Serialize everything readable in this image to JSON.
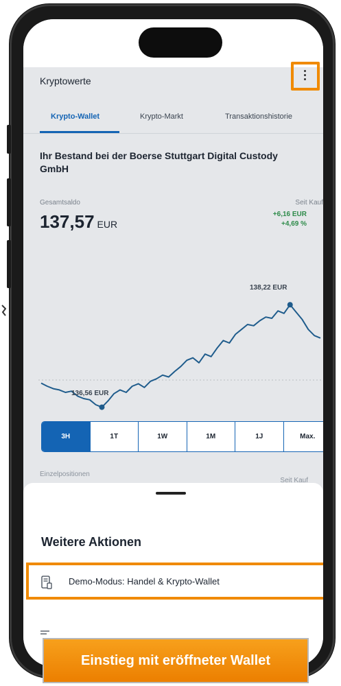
{
  "header": {
    "title": "Kryptowerte",
    "menu_icon": "more-vertical-icon"
  },
  "tabs": [
    {
      "label": "Krypto-Wallet",
      "active": true
    },
    {
      "label": "Krypto-Markt",
      "active": false
    },
    {
      "label": "Transaktionshistorie",
      "active": false
    }
  ],
  "holdings": {
    "title": "Ihr Bestand bei der Boerse Stuttgart Digital Custody GmbH",
    "total_label": "Gesamtsaldo",
    "total_value": "137,57",
    "total_currency": "EUR",
    "since_label": "Seit Kauf",
    "gain_absolute": "+6,16 EUR",
    "gain_percent": "+4,69 %"
  },
  "chart_data": {
    "type": "line",
    "annotations": {
      "max": "138,22 EUR",
      "min": "136,56 EUR"
    },
    "y_approx_range": [
      136.4,
      138.4
    ],
    "values": [
      136.95,
      136.9,
      136.86,
      136.84,
      136.8,
      136.82,
      136.74,
      136.7,
      136.68,
      136.6,
      136.56,
      136.66,
      136.78,
      136.84,
      136.8,
      136.9,
      136.94,
      136.88,
      136.98,
      137.02,
      137.08,
      137.05,
      137.14,
      137.22,
      137.32,
      137.36,
      137.28,
      137.42,
      137.38,
      137.52,
      137.64,
      137.6,
      137.74,
      137.82,
      137.9,
      137.88,
      137.96,
      138.02,
      138.0,
      138.12,
      138.08,
      138.22,
      138.1,
      137.98,
      137.82,
      137.72,
      137.68
    ],
    "reference_line": 137.0,
    "colors": {
      "line": "#1f5c8c",
      "reference": "#b9bdc3"
    }
  },
  "range": {
    "options": [
      "3H",
      "1T",
      "1W",
      "1M",
      "1J",
      "Max."
    ],
    "selected": "3H"
  },
  "positions": {
    "label": "Einzelpositionen",
    "since_label": "Seit Kauf"
  },
  "sheet": {
    "title": "Weitere Aktionen",
    "action_label": "Demo-Modus: Handel & Krypto-Wallet",
    "action_icon": "document-device-icon",
    "next_icon": "document-icon"
  },
  "callout": {
    "text": "Einstieg mit eröffneter Wallet"
  },
  "colors": {
    "accent": "#1464b4",
    "highlight": "#f08a00",
    "gain": "#2e8b4a"
  }
}
